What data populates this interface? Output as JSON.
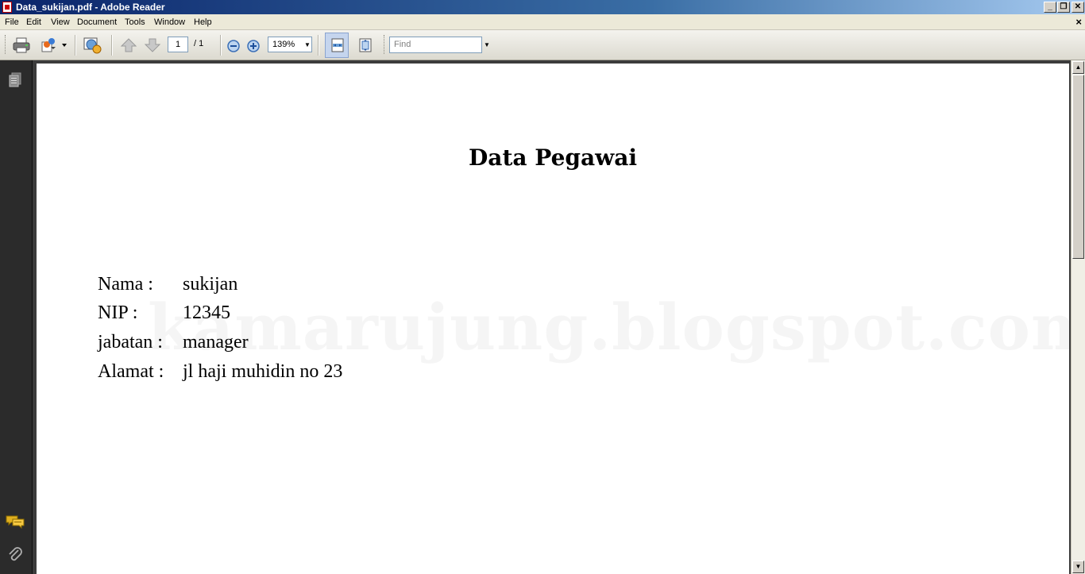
{
  "window": {
    "title": "Data_sukijan.pdf - Adobe Reader",
    "controls": {
      "minimize": "_",
      "restore": "❐",
      "close": "✕"
    }
  },
  "menu": {
    "items": [
      "File",
      "Edit",
      "View",
      "Document",
      "Tools",
      "Window",
      "Help"
    ],
    "doc_close": "×"
  },
  "toolbar": {
    "current_page": "1",
    "page_total": "/ 1",
    "zoom": "139%",
    "find_placeholder": "Find",
    "icons": [
      "print-icon",
      "share-icon",
      "collaborate-icon",
      "previous-page-icon",
      "next-page-icon",
      "zoom-out-icon",
      "zoom-in-icon",
      "fit-width-icon",
      "fit-page-icon"
    ]
  },
  "navpanel": {
    "icons": [
      "pages-icon",
      "comments-icon",
      "attachments-icon"
    ]
  },
  "document": {
    "title": "Data Pegawai",
    "watermark": "kamarujung.blogspot.com",
    "fields": [
      {
        "label": "Nama :",
        "value": "sukijan"
      },
      {
        "label": "NIP :",
        "value": "12345"
      },
      {
        "label": "jabatan :",
        "value": "manager"
      },
      {
        "label": "Alamat :",
        "value": "jl haji muhidin no 23"
      }
    ]
  },
  "colors": {
    "titlebar_start": "#0a246a",
    "titlebar_end": "#a6caf0",
    "chrome": "#ece9d8",
    "nav_panel": "#2b2b2b",
    "page": "#ffffff"
  }
}
